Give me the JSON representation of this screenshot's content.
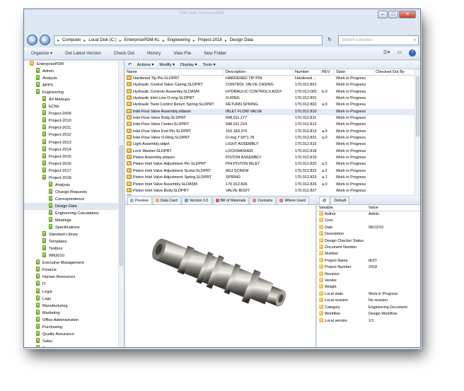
{
  "window": {
    "title": "PDM Vault - EnterprisePDM",
    "minimize": "–",
    "maximize": "□",
    "close": "✕"
  },
  "address": {
    "back": "◄",
    "forward": "►",
    "crumbs": [
      "Computer",
      "Local Disk (C:)",
      "EnterprisePDM-KL",
      "Engineering",
      "Project-2018",
      "Design Data"
    ],
    "refresh": "↻",
    "search_placeholder": "Search Libraries"
  },
  "commands": [
    "Organize ▾",
    "Get Latest Version",
    "Check Out",
    "History",
    "View File",
    "New Folder"
  ],
  "actions": [
    "Actions ▾",
    "Modify ▾",
    "Display ▾",
    "Tools ▾"
  ],
  "tree": [
    {
      "label": "EnterprisePDM",
      "indent": 0,
      "icon": "vault"
    },
    {
      "label": "Admin",
      "indent": 1,
      "icon": "folder"
    },
    {
      "label": "Analysis",
      "indent": 1,
      "icon": "folder"
    },
    {
      "label": "APPS",
      "indent": 1,
      "icon": "folder"
    },
    {
      "label": "Engineering",
      "indent": 1,
      "icon": "folder"
    },
    {
      "label": "AV-Markups",
      "indent": 2,
      "icon": "folder"
    },
    {
      "label": "ECNs",
      "indent": 2,
      "icon": "folder"
    },
    {
      "label": "Project-2009",
      "indent": 2,
      "icon": "folder"
    },
    {
      "label": "Project-2010",
      "indent": 2,
      "icon": "folder"
    },
    {
      "label": "Project-2011",
      "indent": 2,
      "icon": "folder"
    },
    {
      "label": "Project-2012",
      "indent": 2,
      "icon": "folder"
    },
    {
      "label": "Project-2013",
      "indent": 2,
      "icon": "folder"
    },
    {
      "label": "Project-2014",
      "indent": 2,
      "icon": "folder"
    },
    {
      "label": "Project-2015",
      "indent": 2,
      "icon": "folder"
    },
    {
      "label": "Project-2016",
      "indent": 2,
      "icon": "folder"
    },
    {
      "label": "Project-2017",
      "indent": 2,
      "icon": "folder"
    },
    {
      "label": "Project-2018",
      "indent": 2,
      "icon": "folder"
    },
    {
      "label": "Analysis",
      "indent": 3,
      "icon": "folder"
    },
    {
      "label": "Change Requests",
      "indent": 3,
      "icon": "folder"
    },
    {
      "label": "Correspondence",
      "indent": 3,
      "icon": "folder"
    },
    {
      "label": "Design Data",
      "indent": 3,
      "icon": "folder",
      "selected": true
    },
    {
      "label": "Engineering Calculations",
      "indent": 3,
      "icon": "folder"
    },
    {
      "label": "Meetings",
      "indent": 3,
      "icon": "folder"
    },
    {
      "label": "Specifications",
      "indent": 3,
      "icon": "folder"
    },
    {
      "label": "Standard Library",
      "indent": 2,
      "icon": "folder"
    },
    {
      "label": "Templates",
      "indent": 2,
      "icon": "folder"
    },
    {
      "label": "Toolbox",
      "indent": 2,
      "icon": "folder"
    },
    {
      "label": "WN2010",
      "indent": 2,
      "icon": "folder"
    },
    {
      "label": "Executive Management",
      "indent": 1,
      "icon": "folder"
    },
    {
      "label": "Finance",
      "indent": 1,
      "icon": "folder"
    },
    {
      "label": "Human Resources",
      "indent": 1,
      "icon": "folder"
    },
    {
      "label": "IT",
      "indent": 1,
      "icon": "folder"
    },
    {
      "label": "Legal",
      "indent": 1,
      "icon": "folder"
    },
    {
      "label": "Logs",
      "indent": 1,
      "icon": "folder"
    },
    {
      "label": "Manufacturing",
      "indent": 1,
      "icon": "folder"
    },
    {
      "label": "Marketing",
      "indent": 1,
      "icon": "folder"
    },
    {
      "label": "Office Administration",
      "indent": 1,
      "icon": "folder"
    },
    {
      "label": "Purchasing",
      "indent": 1,
      "icon": "folder"
    },
    {
      "label": "Quality Assurance",
      "indent": 1,
      "icon": "folder"
    },
    {
      "label": "Sales",
      "indent": 1,
      "icon": "folder"
    },
    {
      "label": "Service",
      "indent": 1,
      "icon": "folder"
    }
  ],
  "filelist": {
    "columns": [
      "Name",
      "Description",
      "Number",
      "REV",
      "State",
      "Checked Out By"
    ],
    "rows": [
      [
        "Hardened Tip Pin.SLDPRT",
        "HARDENED TIP PIN",
        "Hardened ...",
        "",
        "Work in Progress",
        ""
      ],
      [
        "Hydraulic Control Valve Casing.SLDPRT",
        "CONTROL VALVE CASING",
        "170.012.801",
        "",
        "Work in Progress",
        ""
      ],
      [
        "Hydraulic Controls Assembly.SLDASM",
        "HYDRAULIC CONTROLS ASSY",
        "170-012-001",
        "b.0",
        "Work in Progress",
        ""
      ],
      [
        "Hydraulic Inlet Line O-ring.SLDPRT",
        "O-RING",
        "170.012.801",
        "",
        "Work in Progress",
        ""
      ],
      [
        "Hydraulic Twist Control Return Spring.SLDPRT",
        "RETURN SPRING",
        "170.012.802",
        "a.0",
        "Work in Progress",
        ""
      ],
      [
        "Inlet Flow Valve Assembly.sldasm",
        "INLET  FLOW VALVE",
        "170.012.810",
        "",
        "Work in Progress",
        ""
      ],
      [
        "Inlet Flow Valve Body.SLDPRT",
        "648.011.177",
        "170.012.811",
        "",
        "Work in Progress",
        ""
      ],
      [
        "Inlet Flow Valve Center.SLDPRT",
        "648.011.224",
        "170.012.812",
        "",
        "Work in Progress",
        ""
      ],
      [
        "Inlet Flow Valve End Pin.SLDPRT",
        "150.183.375",
        "170.012.813",
        "a.0",
        "Work in Progress",
        ""
      ],
      [
        "Inlet Flow Valve O-Ring.SLDPRT",
        "O-ring 7.65*1.78",
        "170.012.801",
        "a.0",
        "Work in Progress",
        ""
      ],
      [
        "Light Assembly.sldprt",
        "LIGHT ASSEMBLY",
        "170.012.815",
        "",
        "Work in Progress",
        ""
      ],
      [
        "Lock Washer.SLDPRT",
        "LOCKWASHER",
        "170.012.818",
        "",
        "Work in Progress",
        ""
      ],
      [
        "Piston Assembly.sldasm",
        "PISTON ASSEMBLY",
        "170.012.819",
        "",
        "Work in Progress",
        ""
      ],
      [
        "Piston Inlet Valve Adjustment Pin.SLDPRT",
        "PIN-PISTON INLET",
        "170.012.820",
        "a.2",
        "Work in Progress",
        ""
      ],
      [
        "Piston Inlet Valve Adjustment Screw.SLDPRT",
        "ADJ SCREW",
        "170.012.822",
        "a.2",
        "Work in Progress",
        ""
      ],
      [
        "Piston Inlet Valve Adjustment Spring.SLDPRT",
        "SPRING",
        "170.012.823",
        "a.1",
        "Work in Progress",
        ""
      ],
      [
        "Piston Inlet Valve Assembly.SLDASM",
        "170.012.826",
        "170.012.826",
        "a.0",
        "Work in Progress",
        ""
      ],
      [
        "Piston Inlet Valve Body.SLDPRT",
        "VALVE BODY",
        "170.012.827",
        "",
        "Work in Progress",
        ""
      ],
      [
        "Piston Inlet Valve Pin.SLDPRT",
        "VALVE PIN",
        "170.012.828",
        "",
        "Work in Progress",
        ""
      ]
    ]
  },
  "tabs": [
    "Preview",
    "Data Card",
    "Version 1/1",
    "Bill of Materials",
    "Contains",
    "Where Used"
  ],
  "props": {
    "tabs": [
      "@",
      "Default"
    ],
    "columns": [
      "Variable",
      "Value"
    ],
    "rows": [
      [
        "Author",
        "Admin"
      ],
      [
        "Cost",
        ""
      ],
      [
        "Date",
        "08/12/10"
      ],
      [
        "Description",
        ""
      ],
      [
        "Design Checker Status",
        ""
      ],
      [
        "Document Number",
        ""
      ],
      [
        "Number",
        ""
      ],
      [
        "Project Name",
        "tEST"
      ],
      [
        "Project Number",
        "2018"
      ],
      [
        "Revision",
        ""
      ],
      [
        "Vendor",
        ""
      ],
      [
        "Weight",
        ""
      ],
      [
        "Local state",
        "Work in Progress"
      ],
      [
        "Local revision",
        "No revision"
      ],
      [
        "Category",
        "Engineering Document"
      ],
      [
        "Workflow",
        "Design Workflow"
      ],
      [
        "Local version",
        "1/1"
      ]
    ]
  },
  "colors": {
    "accent": "#2c69b0",
    "selection": "#e4ebf4"
  }
}
